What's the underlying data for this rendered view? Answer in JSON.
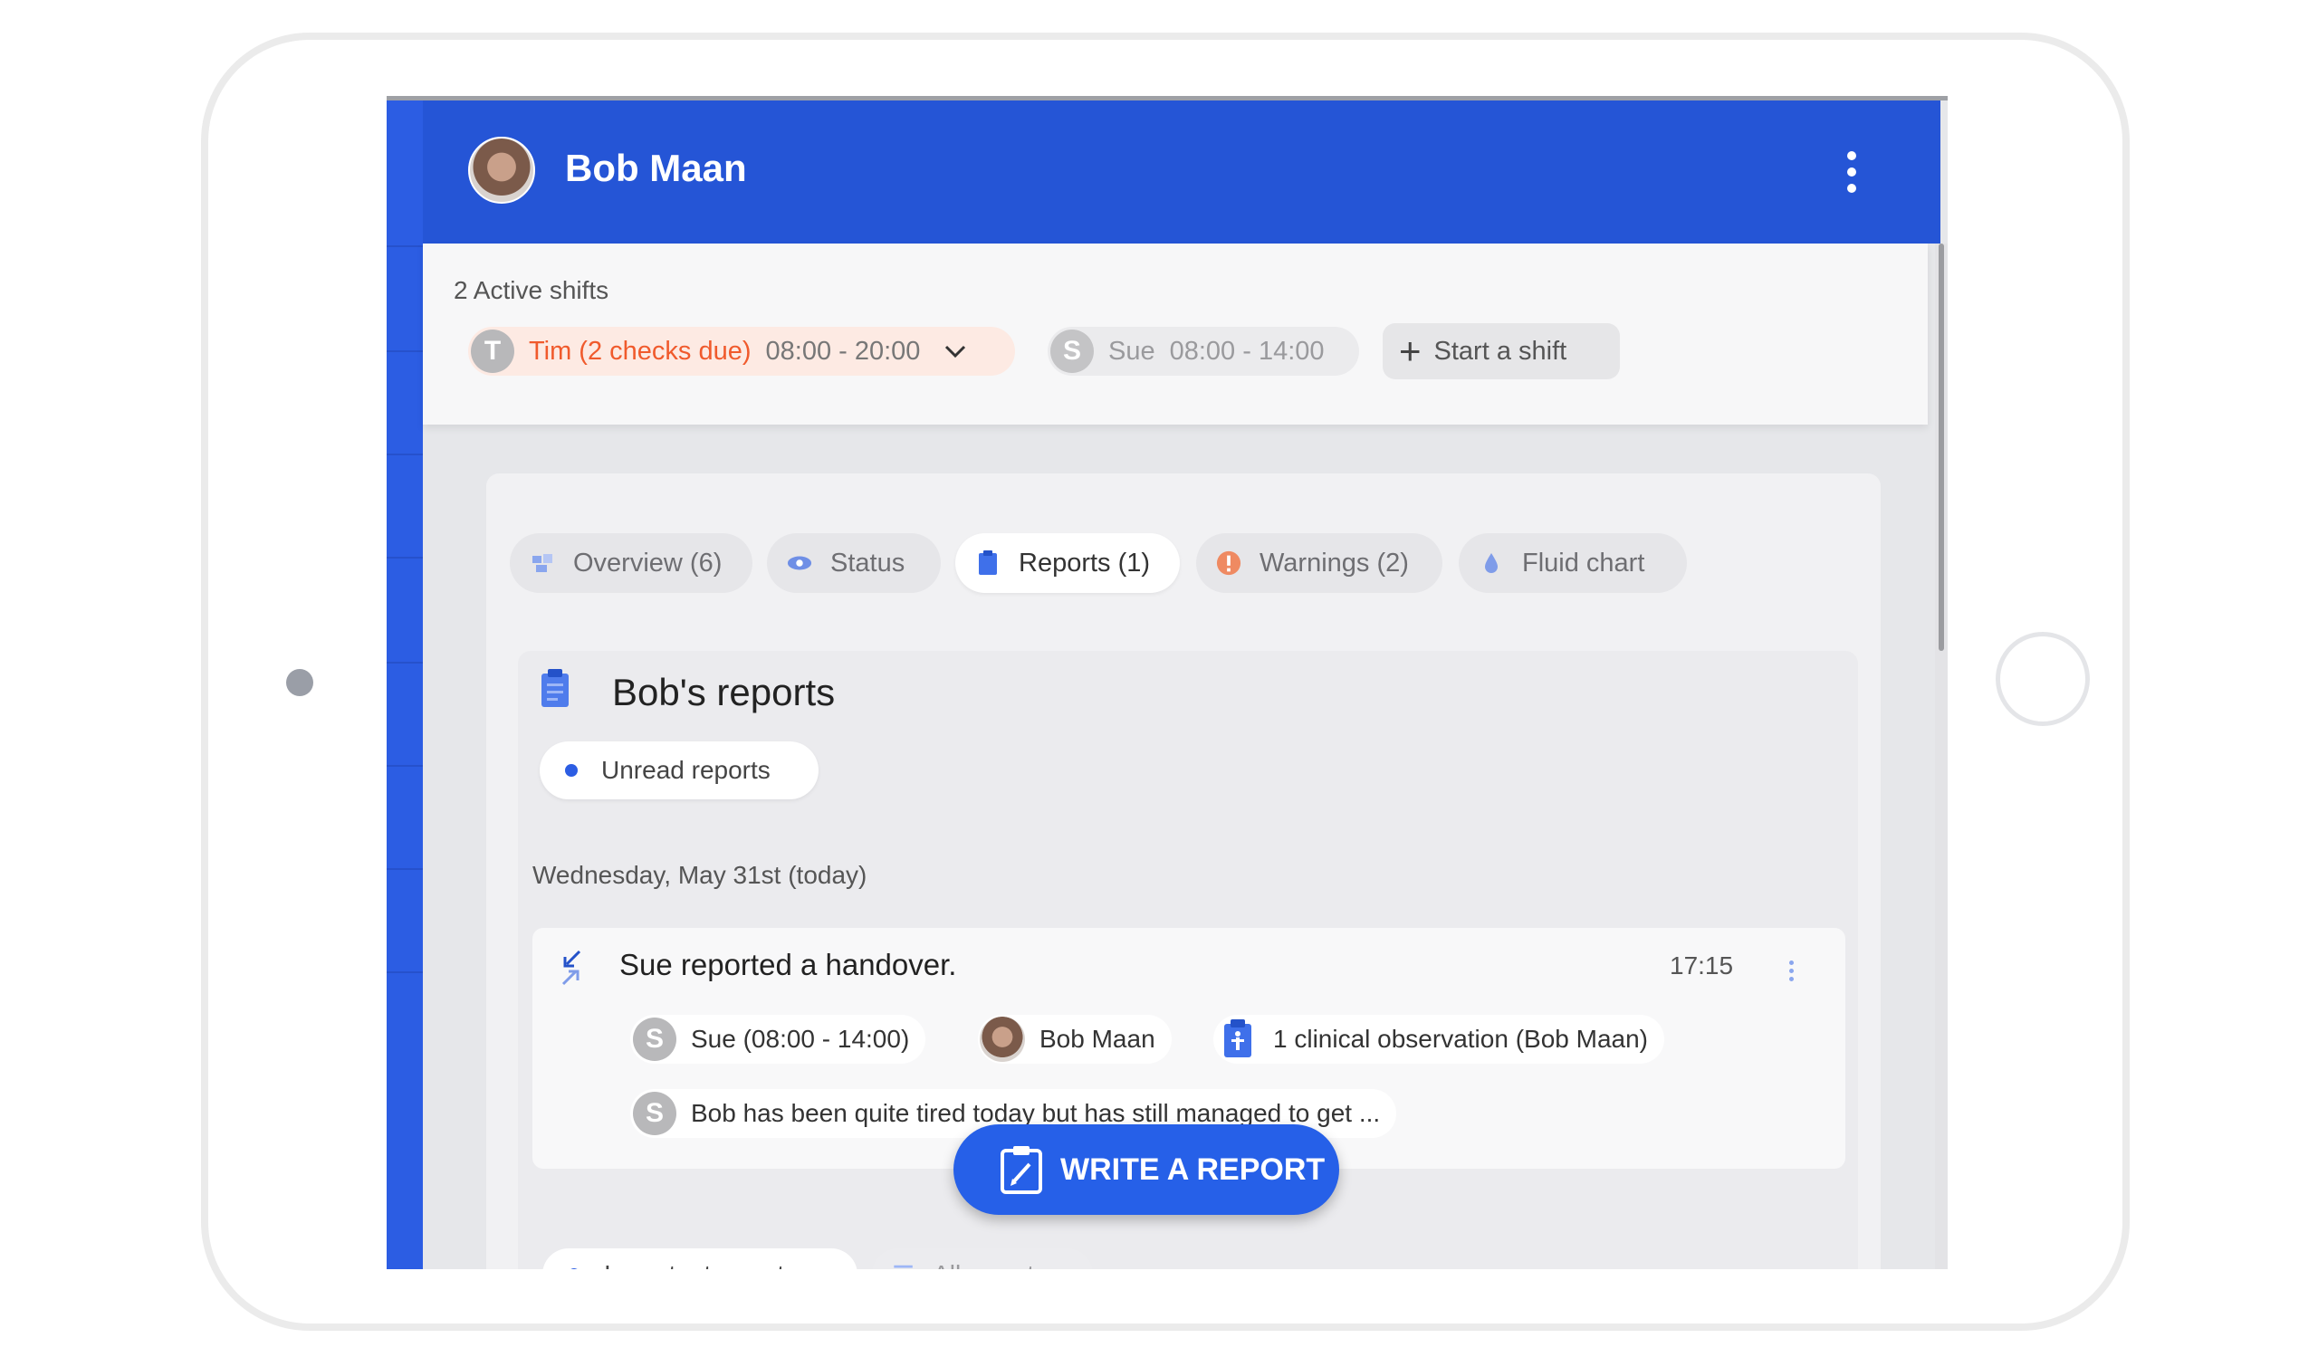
{
  "header": {
    "title": "Bob Maan"
  },
  "shifts": {
    "label": "2 Active shifts",
    "items": [
      {
        "initial": "T",
        "label": "Tim (2 checks due)",
        "time": "08:00 - 20:00"
      },
      {
        "initial": "S",
        "label": "Sue",
        "time": "08:00 - 14:00"
      }
    ],
    "start_label": "Start a shift"
  },
  "tabs": [
    {
      "label": "Overview (6)",
      "icon": "overview-icon"
    },
    {
      "label": "Status",
      "icon": "eye-icon"
    },
    {
      "label": "Reports (1)",
      "icon": "clipboard-icon",
      "active": true
    },
    {
      "label": "Warnings (2)",
      "icon": "warning-icon"
    },
    {
      "label": "Fluid chart",
      "icon": "droplet-icon"
    }
  ],
  "reports": {
    "title": "Bob's reports",
    "unread_label": "Unread reports",
    "date_label": "Wednesday, May 31st (today)",
    "item": {
      "title": "Sue reported a handover.",
      "time": "17:15",
      "author_initial": "S",
      "author": "Sue (08:00 - 14:00)",
      "resident": "Bob Maan",
      "observation": "1 clinical observation (Bob Maan)",
      "note_initial": "S",
      "note": "Bob has been quite tired today but has still managed to get ..."
    },
    "bottom_filters": [
      "Important reports",
      "All reports"
    ]
  },
  "fab": {
    "label": "WRITE A REPORT"
  },
  "colors": {
    "primary": "#2555d6",
    "warning": "#f05a2c"
  }
}
